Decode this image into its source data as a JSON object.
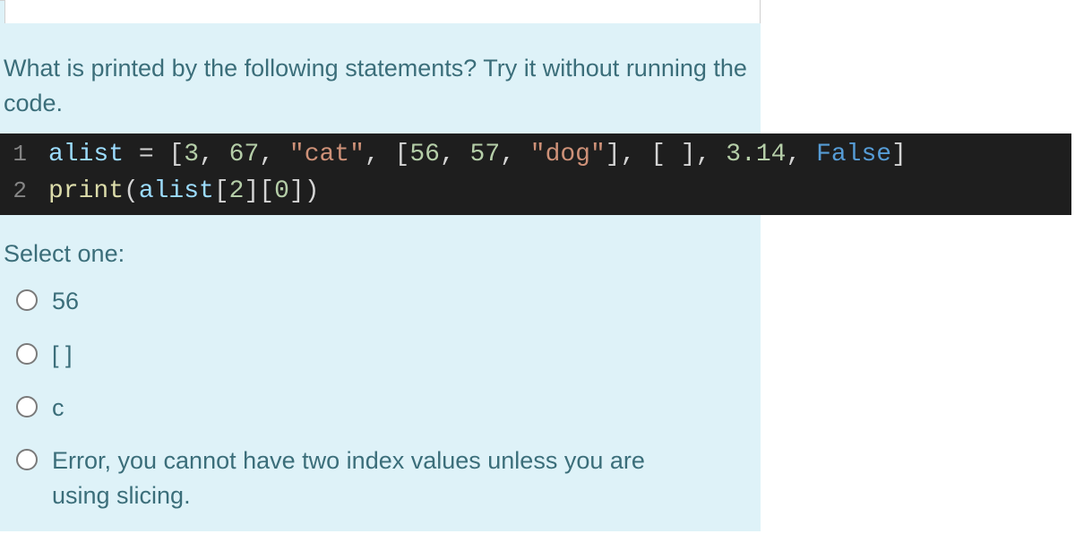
{
  "question": {
    "prompt": "What is printed by the following statements? Try it without running the code.",
    "code": {
      "line1": {
        "num": "1",
        "var": "alist",
        "eq": " = ",
        "open": "[",
        "n1": "3",
        "c1": ", ",
        "n2": "67",
        "c2": ", ",
        "s1": "\"cat\"",
        "c3": ", ",
        "open2": "[",
        "n3": "56",
        "c4": ", ",
        "n4": "57",
        "c5": ", ",
        "s2": "\"dog\"",
        "close2": "]",
        "c6": ", ",
        "open3": "[ ]",
        "c7": ", ",
        "n5": "3.14",
        "c8": ", ",
        "b1": "False",
        "close": "]"
      },
      "line2": {
        "num": "2",
        "func": "print",
        "open": "(",
        "var": "alist",
        "idx": "[",
        "n1": "2",
        "idxc": "][",
        "n2": "0",
        "idxe": "]",
        "close": ")"
      }
    },
    "select_label": "Select one:",
    "options": [
      {
        "label": "56"
      },
      {
        "label": "[ ]"
      },
      {
        "label": "c"
      },
      {
        "label": "Error, you cannot have two index values unless you are using slicing."
      }
    ]
  }
}
